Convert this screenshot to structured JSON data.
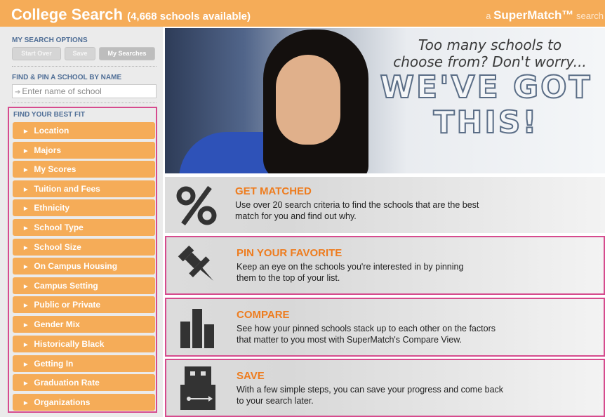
{
  "header": {
    "title": "College Search",
    "count": "(4,668 schools available)",
    "brand_prefix": "a ",
    "brand_name": "SuperMatch™",
    "brand_suffix": " search"
  },
  "sidebar": {
    "options_title": "MY SEARCH OPTIONS",
    "buttons": [
      "Start Over",
      "Save",
      "My Searches"
    ],
    "find_title": "FIND & PIN A SCHOOL BY NAME",
    "search_placeholder": "Enter name of school",
    "fit_title": "FIND YOUR BEST FIT",
    "fit_items": [
      "Location",
      "Majors",
      "My Scores",
      "Tuition and Fees",
      "Ethnicity",
      "School Type",
      "School Size",
      "On Campus Housing",
      "Campus Setting",
      "Public or Private",
      "Gender Mix",
      "Historically Black",
      "Getting In",
      "Graduation Rate",
      "Organizations"
    ]
  },
  "hero": {
    "tagline_1": "Too many schools to",
    "tagline_2": "choose from? Don't worry...",
    "big_1": "WE'VE GOT",
    "big_2": "THIS!"
  },
  "features": [
    {
      "title": "GET MATCHED",
      "desc_1": "Use over 20 search criteria to find the schools that are the best",
      "desc_2": "match for you and find out why.",
      "icon": "percent-icon"
    },
    {
      "title": "PIN YOUR FAVORITE",
      "desc_1": "Keep an eye on the schools you're interested in by pinning",
      "desc_2": "them to the top of your list.",
      "icon": "pushpin-icon"
    },
    {
      "title": "COMPARE",
      "desc_1": "See how your pinned schools stack up to each other on the factors",
      "desc_2": "that matter to you most with SuperMatch's Compare View.",
      "icon": "bar-chart-icon"
    },
    {
      "title": "SAVE",
      "desc_1": "With a few simple steps, you can save your progress and come back",
      "desc_2": "to your search later.",
      "icon": "usb-drive-icon"
    }
  ],
  "colors": {
    "accent_orange": "#f5ac58",
    "title_orange": "#ee7c1e",
    "highlight_pink": "#d64b8e",
    "section_blue": "#4f6e96"
  }
}
